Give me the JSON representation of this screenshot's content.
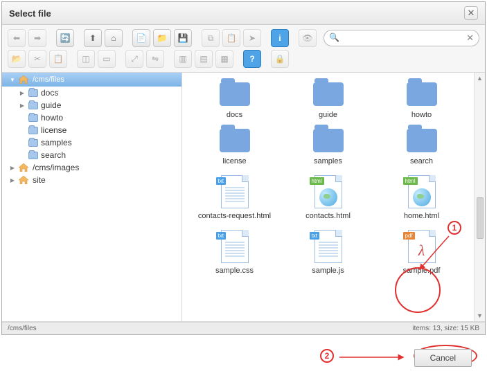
{
  "dialog": {
    "title": "Select file"
  },
  "search": {
    "placeholder": "",
    "value": ""
  },
  "tree": {
    "root": {
      "path": "/cms/files"
    },
    "root_children": [
      {
        "label": "docs",
        "expandable": true
      },
      {
        "label": "guide",
        "expandable": true
      },
      {
        "label": "howto",
        "expandable": false
      },
      {
        "label": "license",
        "expandable": false
      },
      {
        "label": "samples",
        "expandable": false
      },
      {
        "label": "search",
        "expandable": false
      }
    ],
    "siblings": [
      {
        "label": "/cms/images",
        "icon": "home"
      },
      {
        "label": "site",
        "icon": "home"
      }
    ]
  },
  "grid_items": [
    {
      "type": "folder",
      "label": "docs"
    },
    {
      "type": "folder",
      "label": "guide"
    },
    {
      "type": "folder",
      "label": "howto"
    },
    {
      "type": "folder",
      "label": "license"
    },
    {
      "type": "folder",
      "label": "samples"
    },
    {
      "type": "folder",
      "label": "search"
    },
    {
      "type": "file",
      "kind": "txt",
      "label": "contacts-request.html"
    },
    {
      "type": "file",
      "kind": "html",
      "label": "contacts.html"
    },
    {
      "type": "file",
      "kind": "html",
      "label": "home.html"
    },
    {
      "type": "file",
      "kind": "txt",
      "label": "sample.css"
    },
    {
      "type": "file",
      "kind": "txt",
      "label": "sample.js"
    },
    {
      "type": "file",
      "kind": "pdf",
      "label": "sample.pdf"
    }
  ],
  "status": {
    "path": "/cms/files",
    "info": "items: 13, size: 15 KB"
  },
  "footer": {
    "cancel": "Cancel"
  },
  "annotations": {
    "one": "1",
    "two": "2"
  },
  "toolbar": {
    "icons_row1": [
      "arrow-left",
      "arrow-right",
      "reload",
      "arrow-up",
      "home",
      "new-file",
      "new-folder",
      "save",
      "copy",
      "paste",
      "pointer",
      "info",
      "eye"
    ],
    "icons_row2": [
      "open",
      "cut",
      "paste2",
      "crop",
      "view1",
      "resize",
      "flip",
      "panel1",
      "panel2",
      "panel3",
      "help",
      "lock"
    ]
  }
}
